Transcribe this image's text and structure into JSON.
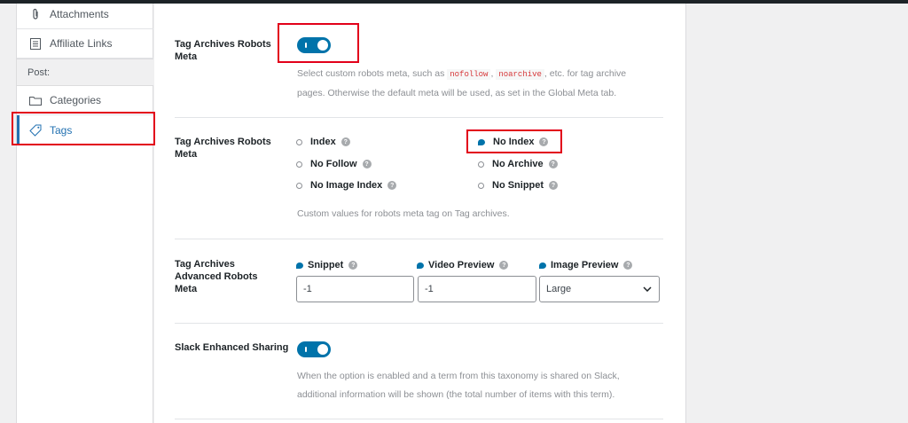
{
  "sidebar": {
    "items": [
      {
        "label": "Attachments",
        "icon": "paperclip-icon"
      },
      {
        "label": "Affiliate Links",
        "icon": "list-icon"
      }
    ],
    "section_header": "Post:",
    "post_items": [
      {
        "label": "Categories",
        "icon": "folder-icon"
      },
      {
        "label": "Tags",
        "icon": "tag-icon",
        "active": true
      }
    ]
  },
  "settings": {
    "robots_meta_toggle": {
      "label": "Tag Archives Robots Meta",
      "enabled": true,
      "desc_pre": "Select custom robots meta, such as",
      "code1": "nofollow",
      "sep": ",",
      "code2": "noarchive",
      "desc_mid": ", etc. for tag archive",
      "desc_line2": "pages. Otherwise the default meta will be used, as set in the Global Meta tab."
    },
    "robots_meta_options": {
      "label": "Tag Archives Robots Meta",
      "options": [
        {
          "label": "Index",
          "checked": false
        },
        {
          "label": "No Index",
          "checked": true
        },
        {
          "label": "No Follow",
          "checked": false
        },
        {
          "label": "No Archive",
          "checked": false
        },
        {
          "label": "No Image Index",
          "checked": false
        },
        {
          "label": "No Snippet",
          "checked": false
        }
      ],
      "desc": "Custom values for robots meta tag on Tag archives."
    },
    "advanced_robots": {
      "label": "Tag Archives Advanced Robots Meta",
      "snippet_label": "Snippet",
      "snippet_value": "-1",
      "video_label": "Video Preview",
      "video_value": "-1",
      "image_label": "Image Preview",
      "image_value": "Large"
    },
    "slack": {
      "label": "Slack Enhanced Sharing",
      "enabled": true,
      "desc_line1": "When the option is enabled and a term from this taxonomy is shared on Slack,",
      "desc_line2": "additional information will be shown (the total number of items with this term)."
    }
  },
  "colors": {
    "accent": "#0073aa",
    "highlight_box": "#e2001a"
  }
}
